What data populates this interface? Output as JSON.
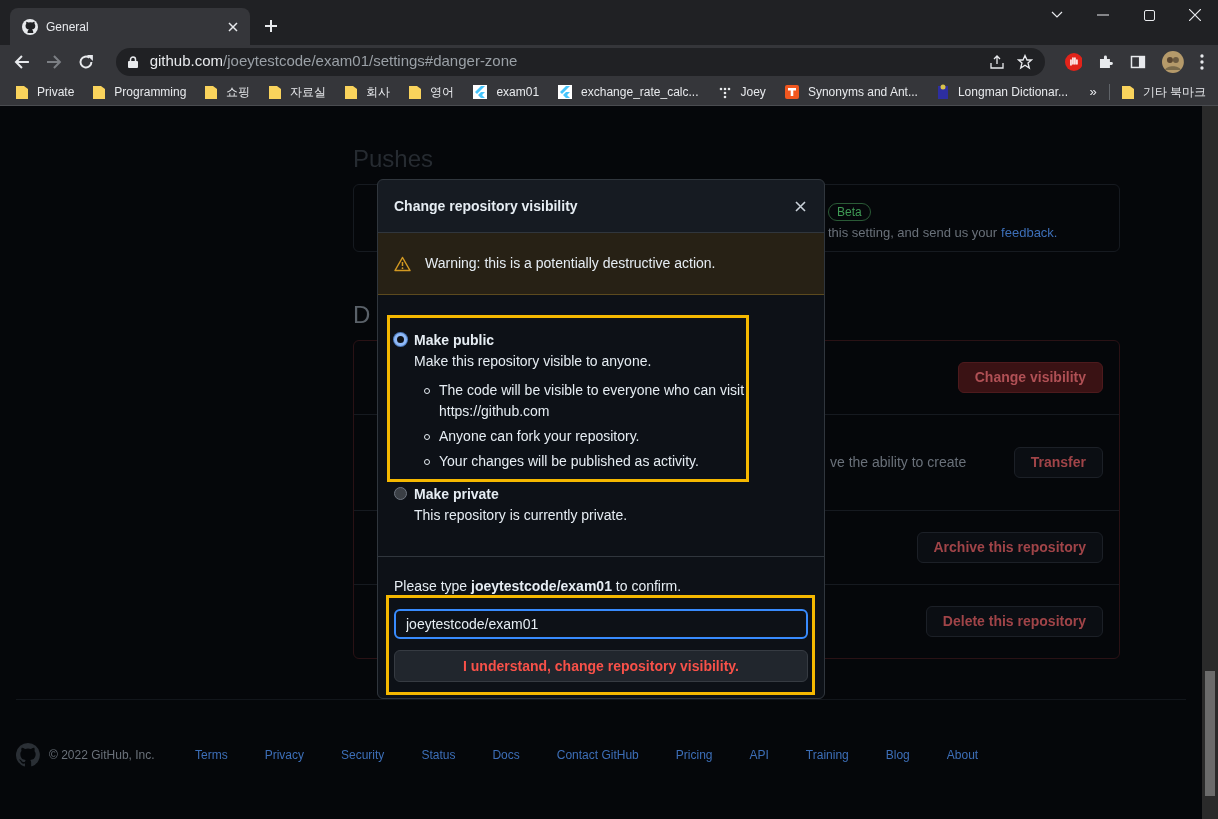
{
  "browser": {
    "tabs": [
      {
        "title": "General",
        "selected": true
      }
    ],
    "address": {
      "host": "github.com",
      "path": "/joeytestcode/exam01/settings#danger-zone"
    },
    "bookmarks": [
      {
        "label": "Private",
        "kind": "folder"
      },
      {
        "label": "Programming",
        "kind": "folder"
      },
      {
        "label": "쇼핑",
        "kind": "folder"
      },
      {
        "label": "자료실",
        "kind": "folder"
      },
      {
        "label": "회사",
        "kind": "folder"
      },
      {
        "label": "영어",
        "kind": "folder"
      },
      {
        "label": "exam01",
        "kind": "flutter"
      },
      {
        "label": "exchange_rate_calc...",
        "kind": "flutter"
      },
      {
        "label": "Joey",
        "kind": "dots"
      },
      {
        "label": "Synonyms and Ant...",
        "kind": "thesaurus"
      },
      {
        "label": "Longman Dictionar...",
        "kind": "longman"
      }
    ],
    "overflow": "»",
    "other_bookmarks": "기타 북마크"
  },
  "page": {
    "pushes_heading": "Pushes",
    "pushes_card": {
      "badge": "Beta",
      "note": "this setting, and send us your",
      "link": "feedback."
    },
    "danger_heading": "D",
    "danger_rows": [
      {
        "button": "Change visibility",
        "kind": "primary"
      },
      {
        "middle": "ve the ability to create",
        "button": "Transfer",
        "kind": "outline"
      },
      {
        "button": "Archive this repository",
        "kind": "outline"
      },
      {
        "button": "Delete this repository",
        "kind": "outline"
      }
    ],
    "footer": {
      "copyright": "© 2022 GitHub, Inc.",
      "links": [
        "Terms",
        "Privacy",
        "Security",
        "Status",
        "Docs",
        "Contact GitHub",
        "Pricing",
        "API",
        "Training",
        "Blog",
        "About"
      ]
    }
  },
  "modal": {
    "title": "Change repository visibility",
    "warning": "Warning: this is a potentially destructive action.",
    "options": [
      {
        "label": "Make public",
        "description": "Make this repository visible to anyone.",
        "bullets": [
          "The code will be visible to everyone who can visit https://github.com",
          "Anyone can fork your repository.",
          "Your changes will be published as activity."
        ],
        "selected": true
      },
      {
        "label": "Make private",
        "description": "This repository is currently private.",
        "selected": false
      }
    ],
    "confirm_prompt": "Please type **joeytestcode/exam01** to confirm.",
    "input_value": "joeytestcode/exam01",
    "submit": "I understand, change repository visibility."
  }
}
